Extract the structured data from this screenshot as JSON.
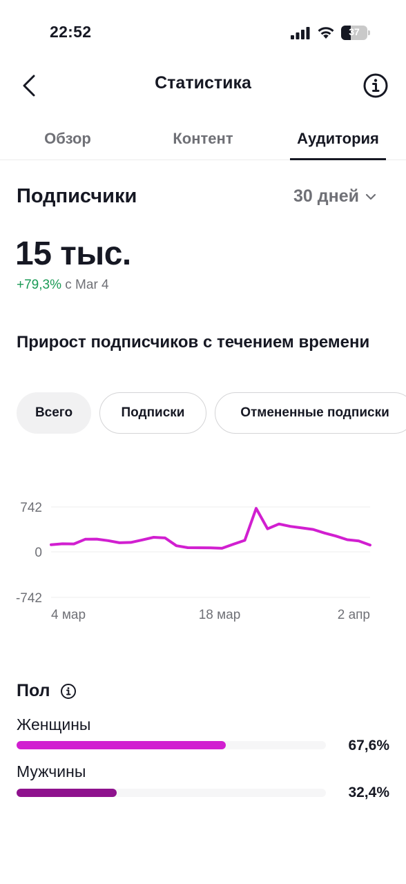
{
  "status_bar": {
    "time": "22:52",
    "battery": "37",
    "battery_level": 0.37,
    "icons": [
      "signal-icon",
      "wifi-icon",
      "battery-icon"
    ]
  },
  "nav": {
    "title": "Статистика",
    "back_icon": "chevron-left-icon",
    "info_icon": "info-icon"
  },
  "tabs": [
    {
      "label": "Обзор",
      "active": false
    },
    {
      "label": "Контент",
      "active": false
    },
    {
      "label": "Аудитория",
      "active": true
    }
  ],
  "followers": {
    "title": "Подписчики",
    "range": "30 дней",
    "total": "15 тыс.",
    "growth": "+79,3%",
    "growth_since": "с Мar 4"
  },
  "growth_section": {
    "title": "Прирост подписчиков с течением времени",
    "filters": [
      {
        "label": "Всего",
        "active": true
      },
      {
        "label": "Подписки",
        "active": false
      },
      {
        "label": "Отмененные подписки",
        "active": false
      }
    ]
  },
  "chart_data": {
    "type": "line",
    "y_ticks": [
      "742",
      "0",
      "-742"
    ],
    "ylim": [
      -742,
      742
    ],
    "x_ticks": [
      "4 мар",
      "18 мар",
      "2 апр"
    ],
    "series": [
      {
        "color": "#d11fd0",
        "values": [
          118,
          132,
          130,
          208,
          210,
          185,
          150,
          155,
          196,
          240,
          230,
          100,
          68,
          67,
          65,
          58,
          125,
          190,
          718,
          380,
          460,
          420,
          395,
          370,
          310,
          260,
          200,
          180,
          112
        ]
      }
    ],
    "grid": true
  },
  "gender": {
    "title": "Пол",
    "info_icon": "info-icon",
    "items": [
      {
        "label": "Женщины",
        "value": "67,6%",
        "fraction": 0.676,
        "color": "#d11fd0"
      },
      {
        "label": "Мужчины",
        "value": "32,4%",
        "fraction": 0.324,
        "color": "#8e128d"
      }
    ]
  },
  "colors": {
    "text": "#161823",
    "secondary": "#6f7076",
    "positive": "#1a9a55",
    "accent": "#d11fd0"
  }
}
